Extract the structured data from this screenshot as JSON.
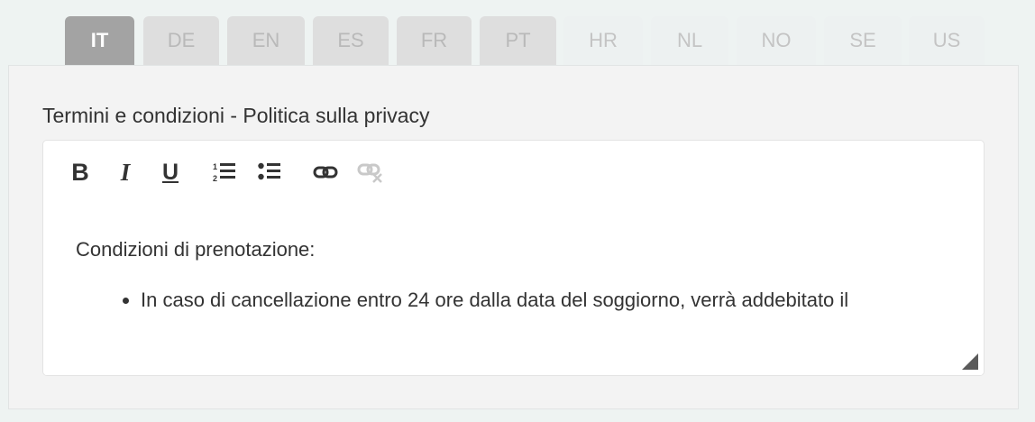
{
  "tabs": [
    {
      "label": "IT",
      "state": "active"
    },
    {
      "label": "DE",
      "state": "filled"
    },
    {
      "label": "EN",
      "state": "filled"
    },
    {
      "label": "ES",
      "state": "filled"
    },
    {
      "label": "FR",
      "state": "filled"
    },
    {
      "label": "PT",
      "state": "filled"
    },
    {
      "label": "HR",
      "state": "empty"
    },
    {
      "label": "NL",
      "state": "empty"
    },
    {
      "label": "NO",
      "state": "empty"
    },
    {
      "label": "SE",
      "state": "empty"
    },
    {
      "label": "US",
      "state": "empty"
    }
  ],
  "field": {
    "label": "Termini e condizioni - Politica sulla privacy"
  },
  "toolbar": {
    "bold": "B",
    "italic": "I",
    "underline": "U",
    "icons": [
      "bold-icon",
      "italic-icon",
      "underline-icon",
      "ordered-list-icon",
      "unordered-list-icon",
      "link-icon",
      "unlink-icon"
    ]
  },
  "editor": {
    "heading": "Condizioni di prenotazione:",
    "bullets": [
      "In caso di cancellazione entro 24 ore dalla data del soggiorno, verrà addebitato il"
    ]
  },
  "colors": {
    "active_tab": "#a3a3a3",
    "filled_tab": "#dedede",
    "panel": "#f3f3f3",
    "page_bg": "#eef3f2"
  }
}
